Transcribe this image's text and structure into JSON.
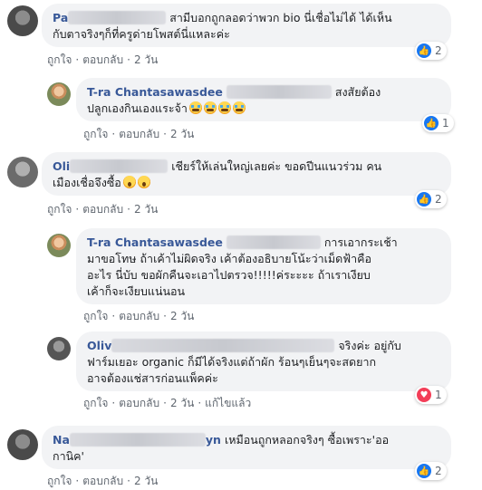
{
  "actions": {
    "like": "ถูกใจ",
    "reply": "ตอบกลับ",
    "sep": "·",
    "edited": "แก้ไขแล้ว"
  },
  "comments": [
    {
      "author": "Pa",
      "line1": "สามีบอกถูกลอดว่าพวก bio นี่เชื่อไม่ได้ ได้เห็น",
      "line2": "กับตาจริงๆก็ที่ครูด่ายโพสต์นี่แหละค่ะ",
      "time": "2 วัน",
      "reaction_count": "2",
      "reaction": "like"
    },
    {
      "author": "T-ra Chantasawasdee",
      "line1_tail": "สงสัยต้อง",
      "line2": "ปลูกเองกินเองแระจ้า",
      "time": "2 วัน",
      "reaction_count": "1",
      "reaction": "like"
    },
    {
      "author": "Oli",
      "line1_tail": "เชียร์ให้เล่นใหญ่เลยค่ะ ขอดปีนแนวร่วม คน",
      "line2": "เมืองเชื่อจึงซื้อ",
      "time": "2 วัน",
      "reaction_count": "2",
      "reaction": "like"
    },
    {
      "author": "T-ra Chantasawasdee",
      "line1_tail": "การเอากระเช้า",
      "line2": "มาขอโทษ ถ้าเค้าไม่ผิดจริง เค้าต้องอธิบายโน้ะว่าเม็ดฟ้าคือ",
      "line3": "อะไร นี่บับ ขอผักคืนจะเอาไปตรวจ!!!!!ค่ระะะะ ถ้าเราเงียบ",
      "line4": "เค้าก็จะเงียบแน่นอน",
      "time": "2 วัน",
      "reaction_count": "",
      "reaction": ""
    },
    {
      "author": "Oliv",
      "line1_tail": "จริงค่ะ อยู่กับ",
      "line2": "ฟาร์มเยอะ organic ก็มีได้จริงแต่ถ้าผัก ร้อนๆเย็นๆจะสดยาก",
      "line3": "อาจต้องแช่สารก่อนแพ็คค่ะ",
      "time": "2 วัน",
      "reaction_count": "1",
      "reaction": "love"
    },
    {
      "author": "Na",
      "author_tail": "yn",
      "line1_tail": "เหมือนถูกหลอกจริงๆ ซื้อเพราะ'ออ",
      "line2": "กานิค'",
      "time": "2 วัน",
      "reaction_count": "2",
      "reaction": "like"
    }
  ]
}
